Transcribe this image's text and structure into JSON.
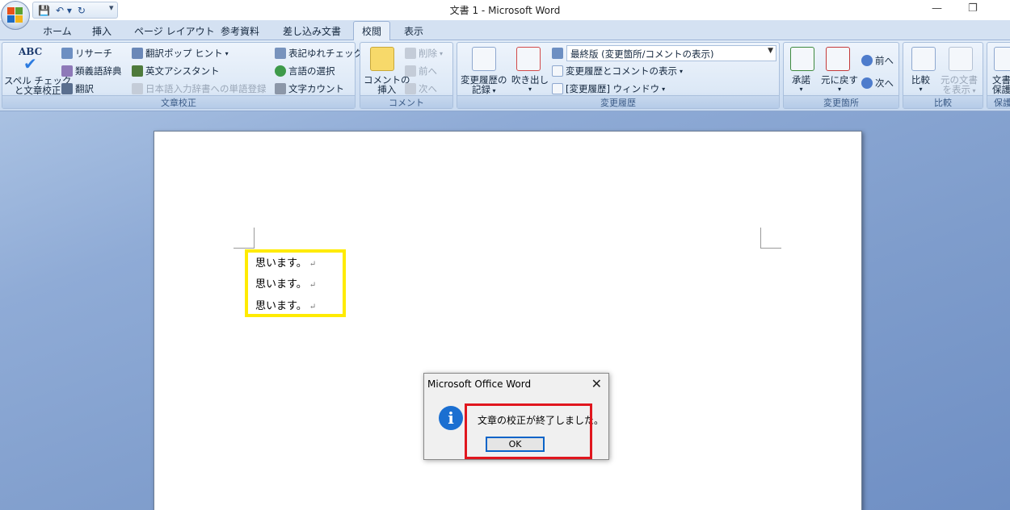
{
  "window": {
    "title": "文書 1 - Microsoft Word",
    "minimize": "—",
    "restore": "❐"
  },
  "qat": {
    "save": "💾",
    "undo": "↶ ▾",
    "redo": "↻",
    "more": "▾"
  },
  "tabs": [
    "ホーム",
    "挿入",
    "ページ レイアウト",
    "参考資料",
    "差し込み文書",
    "校閲",
    "表示"
  ],
  "ribbon": {
    "proofing": {
      "label": "文章校正",
      "spell_icon_text": "ABC",
      "spell": [
        "スペル チェック",
        "と文章校正"
      ],
      "research": "リサーチ",
      "thesaurus": "類義語辞典",
      "translate": "翻訳",
      "translate_tip": "翻訳ポップ ヒント",
      "eng_assist": "英文アシスタント",
      "dict_register": "日本語入力辞書への単語登録",
      "variant_check": "表記ゆれチェック",
      "lang_select": "言語の選択",
      "word_count": "文字カウント"
    },
    "comments": {
      "label": "コメント",
      "insert": [
        "コメントの",
        "挿入"
      ],
      "delete": "削除",
      "prev": "前へ",
      "next": "次へ"
    },
    "tracking": {
      "label": "変更履歴",
      "record": [
        "変更履歴の",
        "記録"
      ],
      "balloon": "吹き出し",
      "display_combo": "最終版 (変更箇所/コメントの表示)",
      "show_markup": "変更履歴とコメントの表示",
      "review_pane": "[変更履歴] ウィンドウ"
    },
    "changes": {
      "label": "変更箇所",
      "accept": "承諾",
      "reject": "元に戻す",
      "prev": "前へ",
      "next": "次へ"
    },
    "compare": {
      "label": "比較",
      "compare": "比較",
      "show_source": [
        "元の文書",
        "を表示"
      ]
    },
    "protect": {
      "label": "保護",
      "protect_doc": [
        "文書",
        "保護"
      ]
    }
  },
  "document": {
    "lines": [
      "思います。",
      "思います。",
      "思います。"
    ],
    "para_mark": "↵"
  },
  "dialog": {
    "title": "Microsoft Office Word",
    "message": "文章の校正が終了しました。",
    "ok": "OK",
    "close": "✕",
    "info_glyph": "i"
  },
  "colors": {
    "highlight_yellow": "#ffeb00",
    "highlight_red": "#e0161e",
    "info_blue": "#1b6fd1"
  }
}
